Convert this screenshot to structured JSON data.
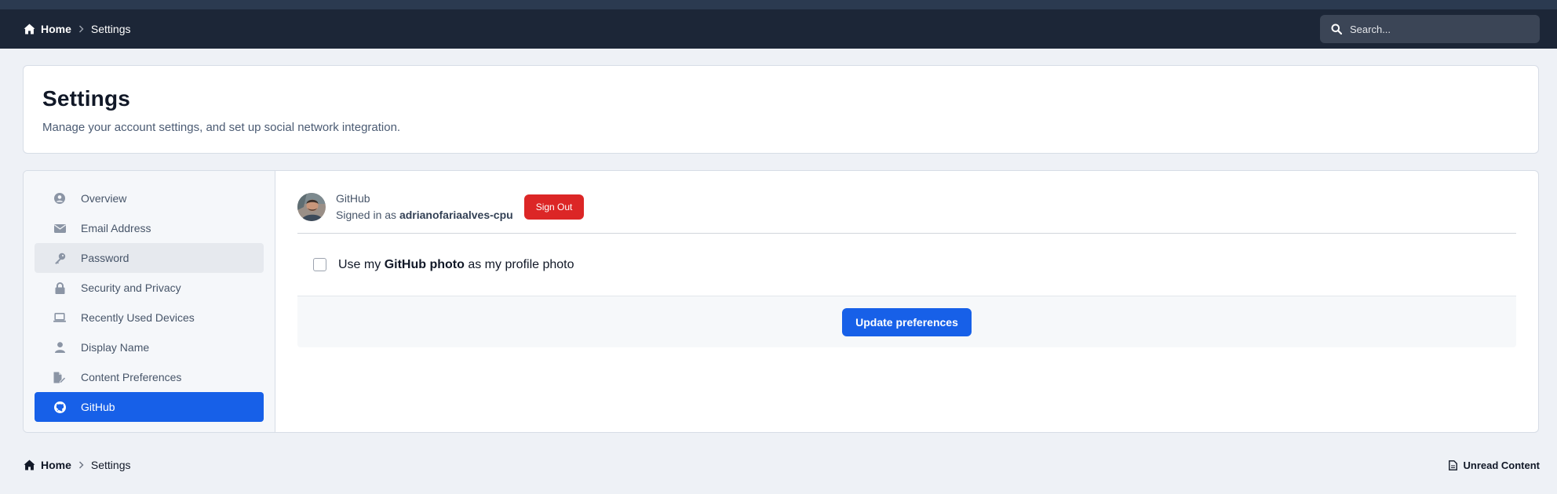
{
  "nav": {
    "breadcrumb": [
      {
        "label": "Home",
        "icon": "home-icon"
      },
      {
        "label": "Settings"
      }
    ],
    "search": {
      "placeholder": "Search...",
      "value": ""
    }
  },
  "header": {
    "title": "Settings",
    "subtitle": "Manage your account settings, and set up social network integration."
  },
  "sidebar": {
    "items": [
      {
        "label": "Overview",
        "icon": "user-circle-icon"
      },
      {
        "label": "Email Address",
        "icon": "envelope-icon"
      },
      {
        "label": "Password",
        "icon": "key-icon"
      },
      {
        "label": "Security and Privacy",
        "icon": "lock-icon"
      },
      {
        "label": "Recently Used Devices",
        "icon": "laptop-icon"
      },
      {
        "label": "Display Name",
        "icon": "user-icon"
      },
      {
        "label": "Content Preferences",
        "icon": "document-edit-icon"
      },
      {
        "label": "GitHub",
        "icon": "github-icon"
      }
    ],
    "active": "GitHub",
    "hovered": "Password"
  },
  "account": {
    "provider": "GitHub",
    "signed_in_prefix": "Signed in as",
    "username": "adrianofariaalves-cpu",
    "sign_out_label": "Sign Out"
  },
  "preference": {
    "label_prefix": "Use my",
    "label_bold": "GitHub photo",
    "label_suffix": "as my profile photo",
    "checked": false
  },
  "actions": {
    "update_label": "Update preferences"
  },
  "footer": {
    "breadcrumb": [
      {
        "label": "Home",
        "icon": "home-icon"
      },
      {
        "label": "Settings"
      }
    ],
    "unread_label": "Unread Content"
  },
  "colors": {
    "navbar": "#1c2637",
    "accent": "#1760e8",
    "danger": "#dc2626",
    "background": "#eef1f6"
  }
}
